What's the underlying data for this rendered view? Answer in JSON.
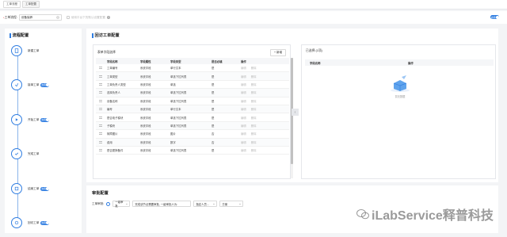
{
  "breadcrumbs": [
    {
      "label": "工单流程"
    },
    {
      "label": "工单配置"
    }
  ],
  "selector": {
    "required_mark": "*",
    "label": "工单流程:",
    "value": "设备保养",
    "clear_icon": "close-circle-icon",
    "option_label": "使用平台下的默认设置配置"
  },
  "top_toggle": {
    "label": "启用"
  },
  "flow_panel": {
    "title": "流程配置",
    "nodes": [
      {
        "label": "新建工单",
        "toggle": false,
        "icon": "file-icon"
      },
      {
        "label": "接单工单",
        "toggle": true,
        "toggle_label": "启用",
        "icon": "receive-icon"
      },
      {
        "label": "开始工单",
        "toggle": true,
        "toggle_label": "启用",
        "icon": "play-icon"
      },
      {
        "label": "完成工单",
        "toggle": false,
        "icon": "check-icon"
      },
      {
        "label": "结案工单",
        "toggle": true,
        "toggle_label": "启用",
        "icon": "close-case-icon"
      },
      {
        "label": "回访工单",
        "toggle": true,
        "toggle_label": "启用",
        "icon": "revisit-icon"
      }
    ]
  },
  "form_panel": {
    "title": "回访工单配置",
    "fields_box": {
      "title": "表单字段选择",
      "add_button": "+ 新增",
      "columns": [
        "字段名称",
        "字段属性",
        "字段类型",
        "是否必填",
        "操作"
      ],
      "rows": [
        {
          "name": "工单编号",
          "attr": "系统字段",
          "type": "单行文本",
          "required": "是",
          "op1": "编辑",
          "op2": "删除"
        },
        {
          "name": "工单类型",
          "attr": "系统字段",
          "type": "单选下拉列表",
          "required": "是",
          "op1": "编辑",
          "op2": "删除"
        },
        {
          "name": "工单负责人类型",
          "attr": "系统字段",
          "type": "单选",
          "required": "是",
          "op1": "编辑",
          "op2": "删除"
        },
        {
          "name": "选择负责人",
          "attr": "系统字段",
          "type": "单选下拉列表",
          "required": "是",
          "op1": "编辑",
          "op2": "删除"
        },
        {
          "name": "设备名称",
          "attr": "系统字段",
          "type": "单选下拉列表",
          "required": "是",
          "op1": "编辑",
          "op2": "删除"
        },
        {
          "name": "编号",
          "attr": "系统字段",
          "type": "单行文本",
          "required": "是",
          "op1": "编辑",
          "op2": "删除"
        },
        {
          "name": "是否电子模块",
          "attr": "系统字段",
          "type": "单选下拉列表",
          "required": "是",
          "op1": "编辑",
          "op2": "删除"
        },
        {
          "name": "子模块",
          "attr": "系统字段",
          "type": "单选下拉列表",
          "required": "是",
          "op1": "编辑",
          "op2": "删除"
        },
        {
          "name": "故障图片",
          "attr": "系统字段",
          "type": "图片",
          "required": "否",
          "op1": "编辑",
          "op2": "删除"
        },
        {
          "name": "费用",
          "attr": "系统字段",
          "type": "数字",
          "required": "否",
          "op1": "编辑",
          "op2": "删除"
        },
        {
          "name": "是否更换备件",
          "attr": "系统字段",
          "type": "单选下拉列表",
          "required": "是",
          "op1": "编辑",
          "op2": "删除"
        }
      ]
    },
    "selected_box": {
      "title": "已选择 (1项)",
      "columns": [
        "字段名称",
        "操作"
      ],
      "empty_label": "暂无数据"
    }
  },
  "approval_panel": {
    "title": "审批配置",
    "flow_label": "工单审批:",
    "radio_label": "一级审批",
    "mode_select": "完成该节点需要审批, 一级审批人为:",
    "person_select": "指定人员...",
    "method_select": "方案"
  },
  "watermark": {
    "text": "iLabService释普科技",
    "icon": "wechat-icon"
  },
  "colors": {
    "accent": "#2f7de1",
    "background": "#f3f4f6"
  }
}
